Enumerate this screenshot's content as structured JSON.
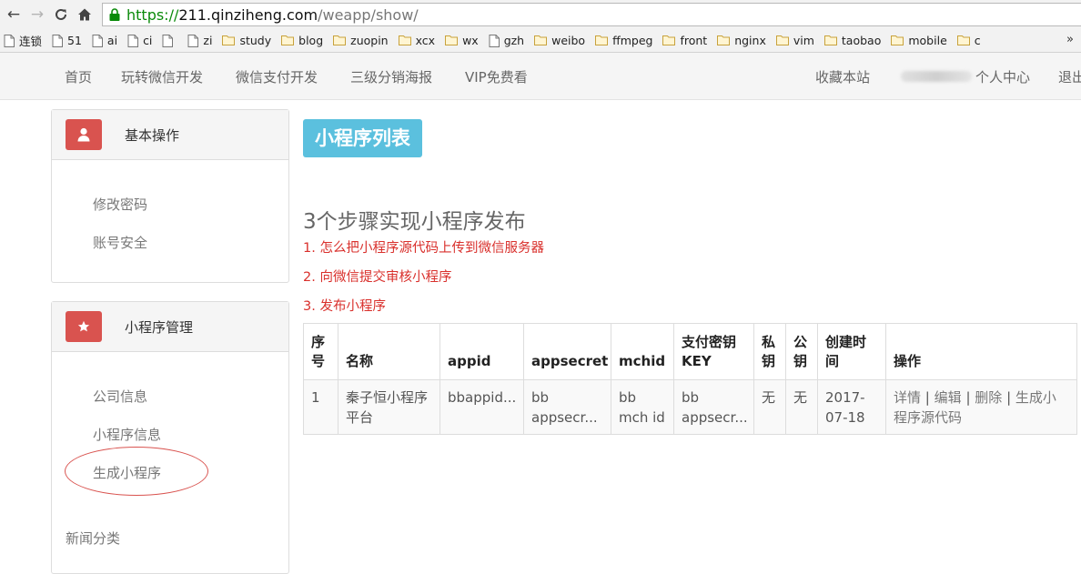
{
  "browser": {
    "url_scheme": "https://",
    "url_host": "211.qinziheng.com",
    "url_path": "/weapp/show/",
    "bookmarks": [
      {
        "label": "连锁",
        "icon": "page"
      },
      {
        "label": "51",
        "icon": "page"
      },
      {
        "label": "ai",
        "icon": "page"
      },
      {
        "label": "ci",
        "icon": "page"
      },
      {
        "label": "",
        "icon": "page"
      },
      {
        "label": "zi",
        "icon": "page"
      },
      {
        "label": "study",
        "icon": "folder"
      },
      {
        "label": "blog",
        "icon": "folder"
      },
      {
        "label": "zuopin",
        "icon": "folder"
      },
      {
        "label": "xcx",
        "icon": "folder"
      },
      {
        "label": "wx",
        "icon": "folder"
      },
      {
        "label": "gzh",
        "icon": "page"
      },
      {
        "label": "weibo",
        "icon": "folder"
      },
      {
        "label": "ffmpeg",
        "icon": "folder"
      },
      {
        "label": "front",
        "icon": "folder"
      },
      {
        "label": "nginx",
        "icon": "folder"
      },
      {
        "label": "vim",
        "icon": "folder"
      },
      {
        "label": "taobao",
        "icon": "folder"
      },
      {
        "label": "mobile",
        "icon": "folder"
      },
      {
        "label": "c",
        "icon": "folder"
      }
    ],
    "more": "»"
  },
  "nav": {
    "home": "首页",
    "wechat_dev": "玩转微信开发",
    "pay_dev": "微信支付开发",
    "poster": "三级分销海报",
    "vip": "VIP免费看",
    "favorite": "收藏本站",
    "profile": "个人中心",
    "logout": "退出"
  },
  "sidebar": {
    "basic": {
      "title": "基本操作",
      "links": [
        "修改密码",
        "账号安全"
      ]
    },
    "miniprogram": {
      "title": "小程序管理",
      "links": [
        "公司信息",
        "小程序信息",
        "生成小程序"
      ]
    },
    "news_category": "新闻分类"
  },
  "main": {
    "page_title": "小程序列表",
    "steps_title": "3个步骤实现小程序发布",
    "steps": [
      "1. 怎么把小程序源代码上传到微信服务器",
      "2. 向微信提交审核小程序",
      "3. 发布小程序"
    ]
  },
  "table": {
    "headers": [
      "序号",
      "名称",
      "appid",
      "appsecret",
      "mchid",
      "支付密钥KEY",
      "私钥",
      "公钥",
      "创建时间",
      "操作"
    ],
    "row": {
      "index": "1",
      "name": "秦子恒小程序平台",
      "appid": "bbappid...",
      "appsecret": "bb appsecr...",
      "mchid": "bb mch id",
      "key": "bb appsecr...",
      "private_key": "无",
      "public_key": "无",
      "created": "2017-07-18",
      "ops": {
        "detail": "详情",
        "edit": "编辑",
        "delete": "删除",
        "generate": "生成小程序源代码",
        "sep": "|"
      }
    }
  },
  "colors": {
    "accent_blue": "#5bc0de",
    "danger_red": "#d9534f",
    "link_red": "#d9302c",
    "url_green": "#0a8a0a"
  }
}
